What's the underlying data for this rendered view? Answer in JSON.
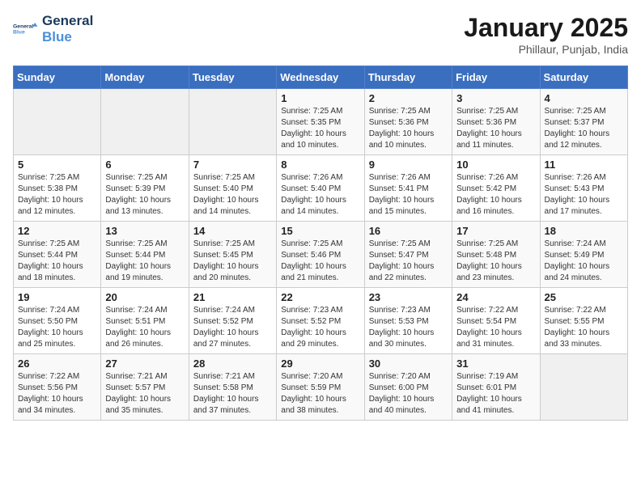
{
  "logo": {
    "line1": "General",
    "line2": "Blue"
  },
  "title": "January 2025",
  "subtitle": "Phillaur, Punjab, India",
  "headers": [
    "Sunday",
    "Monday",
    "Tuesday",
    "Wednesday",
    "Thursday",
    "Friday",
    "Saturday"
  ],
  "weeks": [
    [
      {
        "day": "",
        "sunrise": "",
        "sunset": "",
        "daylight": ""
      },
      {
        "day": "",
        "sunrise": "",
        "sunset": "",
        "daylight": ""
      },
      {
        "day": "",
        "sunrise": "",
        "sunset": "",
        "daylight": ""
      },
      {
        "day": "1",
        "sunrise": "Sunrise: 7:25 AM",
        "sunset": "Sunset: 5:35 PM",
        "daylight": "Daylight: 10 hours and 10 minutes."
      },
      {
        "day": "2",
        "sunrise": "Sunrise: 7:25 AM",
        "sunset": "Sunset: 5:36 PM",
        "daylight": "Daylight: 10 hours and 10 minutes."
      },
      {
        "day": "3",
        "sunrise": "Sunrise: 7:25 AM",
        "sunset": "Sunset: 5:36 PM",
        "daylight": "Daylight: 10 hours and 11 minutes."
      },
      {
        "day": "4",
        "sunrise": "Sunrise: 7:25 AM",
        "sunset": "Sunset: 5:37 PM",
        "daylight": "Daylight: 10 hours and 12 minutes."
      }
    ],
    [
      {
        "day": "5",
        "sunrise": "Sunrise: 7:25 AM",
        "sunset": "Sunset: 5:38 PM",
        "daylight": "Daylight: 10 hours and 12 minutes."
      },
      {
        "day": "6",
        "sunrise": "Sunrise: 7:25 AM",
        "sunset": "Sunset: 5:39 PM",
        "daylight": "Daylight: 10 hours and 13 minutes."
      },
      {
        "day": "7",
        "sunrise": "Sunrise: 7:25 AM",
        "sunset": "Sunset: 5:40 PM",
        "daylight": "Daylight: 10 hours and 14 minutes."
      },
      {
        "day": "8",
        "sunrise": "Sunrise: 7:26 AM",
        "sunset": "Sunset: 5:40 PM",
        "daylight": "Daylight: 10 hours and 14 minutes."
      },
      {
        "day": "9",
        "sunrise": "Sunrise: 7:26 AM",
        "sunset": "Sunset: 5:41 PM",
        "daylight": "Daylight: 10 hours and 15 minutes."
      },
      {
        "day": "10",
        "sunrise": "Sunrise: 7:26 AM",
        "sunset": "Sunset: 5:42 PM",
        "daylight": "Daylight: 10 hours and 16 minutes."
      },
      {
        "day": "11",
        "sunrise": "Sunrise: 7:26 AM",
        "sunset": "Sunset: 5:43 PM",
        "daylight": "Daylight: 10 hours and 17 minutes."
      }
    ],
    [
      {
        "day": "12",
        "sunrise": "Sunrise: 7:25 AM",
        "sunset": "Sunset: 5:44 PM",
        "daylight": "Daylight: 10 hours and 18 minutes."
      },
      {
        "day": "13",
        "sunrise": "Sunrise: 7:25 AM",
        "sunset": "Sunset: 5:44 PM",
        "daylight": "Daylight: 10 hours and 19 minutes."
      },
      {
        "day": "14",
        "sunrise": "Sunrise: 7:25 AM",
        "sunset": "Sunset: 5:45 PM",
        "daylight": "Daylight: 10 hours and 20 minutes."
      },
      {
        "day": "15",
        "sunrise": "Sunrise: 7:25 AM",
        "sunset": "Sunset: 5:46 PM",
        "daylight": "Daylight: 10 hours and 21 minutes."
      },
      {
        "day": "16",
        "sunrise": "Sunrise: 7:25 AM",
        "sunset": "Sunset: 5:47 PM",
        "daylight": "Daylight: 10 hours and 22 minutes."
      },
      {
        "day": "17",
        "sunrise": "Sunrise: 7:25 AM",
        "sunset": "Sunset: 5:48 PM",
        "daylight": "Daylight: 10 hours and 23 minutes."
      },
      {
        "day": "18",
        "sunrise": "Sunrise: 7:24 AM",
        "sunset": "Sunset: 5:49 PM",
        "daylight": "Daylight: 10 hours and 24 minutes."
      }
    ],
    [
      {
        "day": "19",
        "sunrise": "Sunrise: 7:24 AM",
        "sunset": "Sunset: 5:50 PM",
        "daylight": "Daylight: 10 hours and 25 minutes."
      },
      {
        "day": "20",
        "sunrise": "Sunrise: 7:24 AM",
        "sunset": "Sunset: 5:51 PM",
        "daylight": "Daylight: 10 hours and 26 minutes."
      },
      {
        "day": "21",
        "sunrise": "Sunrise: 7:24 AM",
        "sunset": "Sunset: 5:52 PM",
        "daylight": "Daylight: 10 hours and 27 minutes."
      },
      {
        "day": "22",
        "sunrise": "Sunrise: 7:23 AM",
        "sunset": "Sunset: 5:52 PM",
        "daylight": "Daylight: 10 hours and 29 minutes."
      },
      {
        "day": "23",
        "sunrise": "Sunrise: 7:23 AM",
        "sunset": "Sunset: 5:53 PM",
        "daylight": "Daylight: 10 hours and 30 minutes."
      },
      {
        "day": "24",
        "sunrise": "Sunrise: 7:22 AM",
        "sunset": "Sunset: 5:54 PM",
        "daylight": "Daylight: 10 hours and 31 minutes."
      },
      {
        "day": "25",
        "sunrise": "Sunrise: 7:22 AM",
        "sunset": "Sunset: 5:55 PM",
        "daylight": "Daylight: 10 hours and 33 minutes."
      }
    ],
    [
      {
        "day": "26",
        "sunrise": "Sunrise: 7:22 AM",
        "sunset": "Sunset: 5:56 PM",
        "daylight": "Daylight: 10 hours and 34 minutes."
      },
      {
        "day": "27",
        "sunrise": "Sunrise: 7:21 AM",
        "sunset": "Sunset: 5:57 PM",
        "daylight": "Daylight: 10 hours and 35 minutes."
      },
      {
        "day": "28",
        "sunrise": "Sunrise: 7:21 AM",
        "sunset": "Sunset: 5:58 PM",
        "daylight": "Daylight: 10 hours and 37 minutes."
      },
      {
        "day": "29",
        "sunrise": "Sunrise: 7:20 AM",
        "sunset": "Sunset: 5:59 PM",
        "daylight": "Daylight: 10 hours and 38 minutes."
      },
      {
        "day": "30",
        "sunrise": "Sunrise: 7:20 AM",
        "sunset": "Sunset: 6:00 PM",
        "daylight": "Daylight: 10 hours and 40 minutes."
      },
      {
        "day": "31",
        "sunrise": "Sunrise: 7:19 AM",
        "sunset": "Sunset: 6:01 PM",
        "daylight": "Daylight: 10 hours and 41 minutes."
      },
      {
        "day": "",
        "sunrise": "",
        "sunset": "",
        "daylight": ""
      }
    ]
  ]
}
